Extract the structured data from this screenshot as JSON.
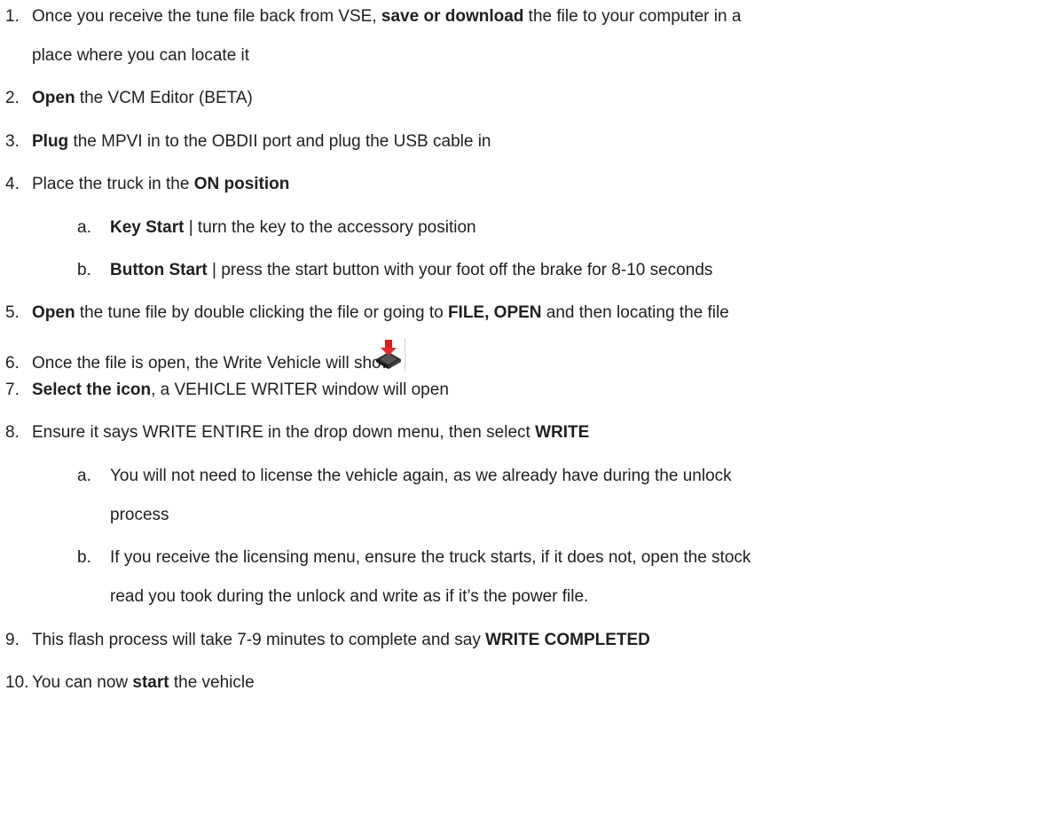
{
  "steps": [
    {
      "n": "1.",
      "a": "Once you receive the tune file back from VSE, ",
      "b": "save or download",
      "c": " the file to your computer in a",
      "d": "place where you can locate it"
    },
    {
      "n": "2.",
      "b": "Open",
      "c": " the VCM Editor (BETA)"
    },
    {
      "n": "3.",
      "b": "Plug",
      "c": " the MPVI in to the OBDII port and plug the USB cable in"
    },
    {
      "n": "4.",
      "a": "Place the truck in the ",
      "b": "ON position"
    },
    {
      "n": "a.",
      "b": "Key Start",
      "c": " | turn the key to the accessory position"
    },
    {
      "n": "b.",
      "b": "Button Start",
      "c": " | press the start button with your foot off the brake for 8-10 seconds"
    },
    {
      "n": "5.",
      "b": "Open",
      "c": " the tune file by double clicking the file or going to ",
      "e": "FILE, OPEN",
      "f": " and then locating the file"
    },
    {
      "n": "6.",
      "a": "Once the file is open, the Write Vehicle will show"
    },
    {
      "n": "7.",
      "b": "Select the icon",
      "c": ", a VEHICLE WRITER window will open"
    },
    {
      "n": "8.",
      "a": "Ensure it says WRITE ENTIRE in the drop down menu, then select ",
      "b": "WRITE"
    },
    {
      "n": "a.",
      "a": "You will not need to license the vehicle again, as we already have during the unlock",
      "d": "process"
    },
    {
      "n": "b.",
      "a": "If you receive the licensing menu, ensure the truck starts, if it does not, open the stock",
      "d": "read you took during the unlock and write as if it’s the power file."
    },
    {
      "n": "9.",
      "a": "This flash process will take 7-9 minutes to complete and say ",
      "b": "WRITE COMPLETED"
    },
    {
      "n": "10.",
      "a": "You can now ",
      "b": "start",
      "c": " the vehicle"
    }
  ],
  "icon": "write-vehicle-chip-icon"
}
